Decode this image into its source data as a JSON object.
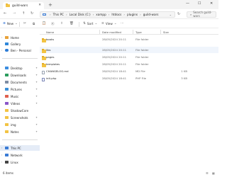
{
  "window": {
    "tab_title": "guild-wars",
    "tab_close_glyph": "✕",
    "new_tab_glyph": "+",
    "minimize_glyph": "—",
    "maximize_glyph": "☐",
    "close_glyph": "✕"
  },
  "nav": {
    "back_glyph": "←",
    "forward_glyph": "→",
    "up_glyph": "↑",
    "refresh_glyph": "↻",
    "breadcrumbs": [
      "This PC",
      "Local Disk (C:)",
      "xampp",
      "htdocs",
      "plugins",
      "guild-wars"
    ],
    "crumb_separator": "›",
    "address_chevron": "⌄",
    "search_placeholder": "Search guild-wars",
    "search_glyph": "⌕"
  },
  "commands": {
    "new_label": "New",
    "new_glyph": "⊕",
    "cut_glyph": "✂",
    "copy_glyph": "⧉",
    "paste_glyph": "📋",
    "rename_glyph": "Ⓐ",
    "share_glyph": "⇪",
    "delete_glyph": "🗑",
    "sort_label": "Sort",
    "sort_glyph": "⇅",
    "view_label": "View",
    "view_glyph": "≡",
    "more_glyph": "···",
    "dropdown_glyph": "⌄"
  },
  "sidebar": {
    "items": [
      {
        "label": "Home",
        "icon": "home-icon",
        "color": "#e8a23a"
      },
      {
        "label": "Gallery",
        "icon": "gallery-icon",
        "color": "#2f87d9"
      },
      {
        "label": "Ben - Personal",
        "icon": "onedrive-icon",
        "color": "#2d7cd6"
      },
      {
        "label": "Desktop",
        "icon": "desktop-icon",
        "color": "#3b8de0"
      },
      {
        "label": "Downloads",
        "icon": "downloads-icon",
        "color": "#2a9c5d"
      },
      {
        "label": "Documents",
        "icon": "documents-icon",
        "color": "#7f8da3"
      },
      {
        "label": "Pictures",
        "icon": "pictures-icon",
        "color": "#3a8fd8"
      },
      {
        "label": "Music",
        "icon": "music-icon",
        "color": "#e0604d"
      },
      {
        "label": "Videos",
        "icon": "videos-icon",
        "color": "#8a56c8"
      },
      {
        "label": "ShadowCore",
        "icon": "folder-icon",
        "color": "#f2c343"
      },
      {
        "label": "Screenshots",
        "icon": "folder-icon",
        "color": "#f2c343"
      },
      {
        "label": "img",
        "icon": "folder-icon",
        "color": "#f2c343"
      },
      {
        "label": "Notes",
        "icon": "folder-icon",
        "color": "#f2c343"
      },
      {
        "label": "This PC",
        "icon": "this-pc-icon",
        "color": "#3a7bd5"
      },
      {
        "label": "Network",
        "icon": "network-icon",
        "color": "#3a7bd5"
      },
      {
        "label": "Linux",
        "icon": "linux-icon",
        "color": "#444444"
      }
    ],
    "chevron_glyph": "›",
    "pin_glyph": "✦"
  },
  "file_list": {
    "columns": {
      "name": "Name",
      "date": "Date modified",
      "type": "Type",
      "size": "Size"
    },
    "rows": [
      {
        "name": "books",
        "date": "28/05/2024 20:11",
        "type": "File folder",
        "size": "",
        "kind": "folder"
      },
      {
        "name": "libs",
        "date": "28/05/2024 20:11",
        "type": "File folder",
        "size": "",
        "kind": "folder"
      },
      {
        "name": "pages",
        "date": "28/05/2024 20:11",
        "type": "File folder",
        "size": "",
        "kind": "folder"
      },
      {
        "name": "templates",
        "date": "28/05/2024 20:11",
        "type": "File folder",
        "size": "",
        "kind": "folder"
      },
      {
        "name": "CHANGELOG.md",
        "date": "28/05/2024 18:41",
        "type": "MD File",
        "size": "1 KB",
        "kind": "file"
      },
      {
        "name": "init.php",
        "date": "28/05/2024 18:41",
        "type": "PHP File",
        "size": "3 KB",
        "kind": "php"
      }
    ]
  },
  "status": {
    "item_count": "6 items",
    "details_view_glyph": "☰",
    "tiles_view_glyph": "▦"
  }
}
